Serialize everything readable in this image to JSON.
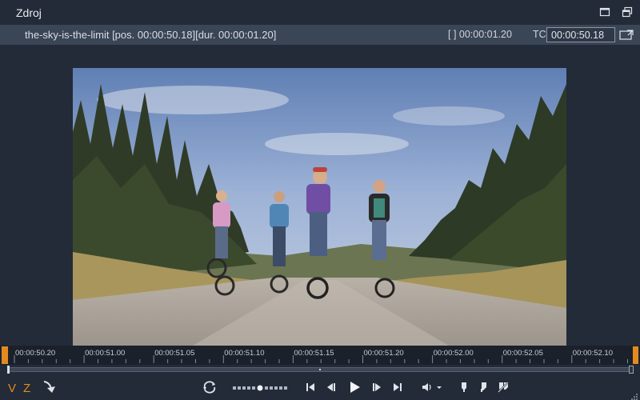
{
  "panel": {
    "title": "Zdroj"
  },
  "clip": {
    "info": "the-sky-is-the-limit [pos. 00:00:50.18][dur. 00:00:01.20]",
    "duration_label": "[ ] 00:00:01.20",
    "tc_label": "TC",
    "timecode": "00:00:50.18"
  },
  "ruler": {
    "ticks": [
      "00:00:50.20",
      "00:00:51.00",
      "00:00:51.05",
      "00:00:51.10",
      "00:00:51.15",
      "00:00:51.20",
      "00:00:52.00",
      "00:00:52.05",
      "00:00:52.10"
    ]
  },
  "marks": {
    "in": "V",
    "out": "Z"
  },
  "icons": {
    "minimize": "minimize-icon",
    "undock": "undock-icon",
    "external": "external-monitor-icon",
    "insert": "insert-arrow-icon",
    "loop": "loop-icon",
    "shuttle": "shuttle-icon",
    "prev": "go-to-start-icon",
    "step_back": "step-back-icon",
    "play": "play-icon",
    "step_fwd": "step-forward-icon",
    "next": "go-to-end-icon",
    "volume": "volume-icon",
    "mark_in": "mark-in-icon",
    "mark_out": "mark-out-icon",
    "clear_marks": "clear-marks-icon"
  },
  "colors": {
    "accent": "#e38a1f",
    "background": "#232b38",
    "infobar": "#3a4556"
  }
}
